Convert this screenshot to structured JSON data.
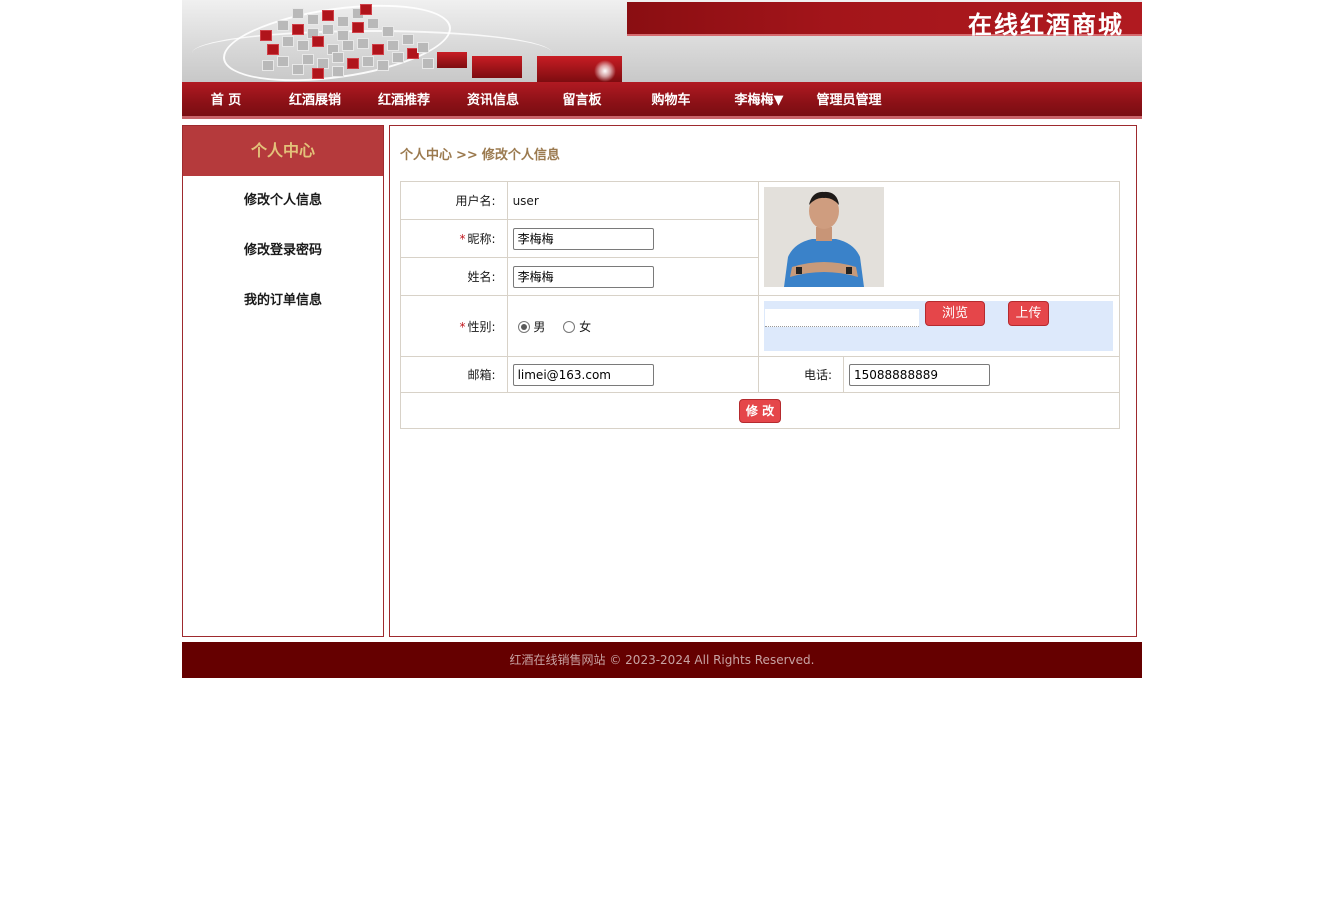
{
  "header": {
    "site_title": "在线红酒商城"
  },
  "nav": {
    "items": [
      {
        "label": "首 页"
      },
      {
        "label": "红酒展销"
      },
      {
        "label": "红酒推荐"
      },
      {
        "label": "资讯信息"
      },
      {
        "label": "留言板"
      },
      {
        "label": "购物车"
      },
      {
        "label": "李梅梅▼"
      },
      {
        "label": "管理员管理"
      }
    ]
  },
  "sidebar": {
    "title": "个人中心",
    "links": [
      {
        "label": "修改个人信息"
      },
      {
        "label": "修改登录密码"
      },
      {
        "label": "我的订单信息"
      }
    ]
  },
  "breadcrumb": {
    "root": "个人中心",
    "sep": ">>",
    "current": "修改个人信息"
  },
  "form": {
    "required_mark": "*",
    "username_label": "用户名:",
    "username_value": "user",
    "nickname_label": "昵称:",
    "nickname_value": "李梅梅",
    "realname_label": "姓名:",
    "realname_value": "李梅梅",
    "gender_label": "性别:",
    "gender_options": [
      "男",
      "女"
    ],
    "gender_selected": "男",
    "email_label": "邮箱:",
    "email_value": "limei@163.com",
    "phone_label": "电话:",
    "phone_value": "15088888889",
    "browse_label": "浏览",
    "upload_label": "上传",
    "submit_label": "修 改"
  },
  "footer": {
    "text": "红酒在线销售网站 © 2023-2024 All Rights Reserved."
  },
  "colors": {
    "brand_red": "#8c1117",
    "footer": "#650000",
    "sidebar_head": "#b53a3c",
    "crumb": "#9b7a4f",
    "button": "#e5464a"
  }
}
